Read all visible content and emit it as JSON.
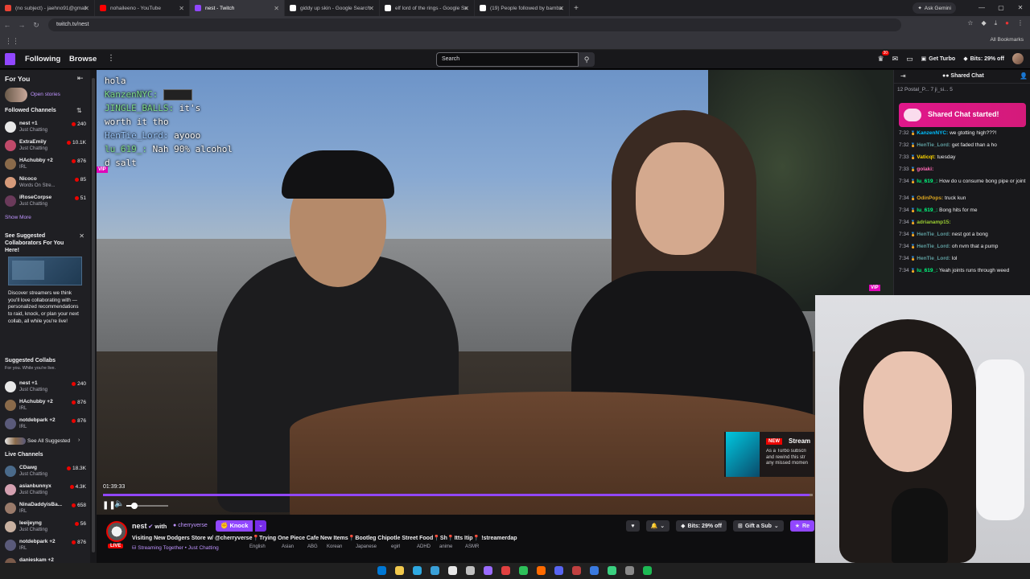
{
  "browser": {
    "tabs": [
      {
        "title": "(no subject) - jaehno91@gmail",
        "fav": "#ea4335"
      },
      {
        "title": "nohaileeno - YouTube",
        "fav": "#ff0000"
      },
      {
        "title": "nest - Twitch",
        "fav": "#9147ff"
      },
      {
        "title": "giddy up skin - Google Search",
        "fav": "#ffffff"
      },
      {
        "title": "elf lord of the rings - Google Se",
        "fav": "#ffffff"
      },
      {
        "title": "(19) People followed by bamba",
        "fav": "#ffffff"
      }
    ],
    "ask_gemini": "Ask Gemini",
    "url": "twitch.tv/nest",
    "all_bookmarks": "All Bookmarks"
  },
  "topnav": {
    "following": "Following",
    "browse": "Browse",
    "search_placeholder": "Search",
    "notif_count": "30",
    "get_turbo": "Get Turbo",
    "bits": "Bits: 29% off"
  },
  "sidebar": {
    "for_you": "For You",
    "open_stories": "Open stories",
    "followed_channels": "Followed Channels",
    "followed": [
      {
        "name": "nest +1",
        "cat": "Just Chatting",
        "viewers": "240",
        "color": "#e8e8e8"
      },
      {
        "name": "ExtraEmily",
        "cat": "Just Chatting",
        "viewers": "10.1K",
        "color": "#c04a6a"
      },
      {
        "name": "HAchubby +2",
        "cat": "IRL",
        "viewers": "876",
        "color": "#8a6a4a"
      },
      {
        "name": "Nicoco",
        "cat": "Words On Stre...",
        "viewers": "85",
        "color": "#d69a7a"
      },
      {
        "name": "iRoseCorpse",
        "cat": "Just Chatting",
        "viewers": "51",
        "color": "#6a3a5a"
      }
    ],
    "show_more": "Show More",
    "collab_title": "See Suggested Collaborators For You Here!",
    "collab_desc": "Discover streamers we think you'll love collaborating with — personalized recommendations to raid, knock, or plan your next collab, all while you're live!",
    "suggested_collabs": "Suggested Collabs",
    "for_you_while_live": "For you. While you're live.",
    "suggested": [
      {
        "name": "nest +1",
        "cat": "Just Chatting",
        "viewers": "240",
        "color": "#e8e8e8"
      },
      {
        "name": "HAchubby +2",
        "cat": "IRL",
        "viewers": "876",
        "color": "#8a6a4a"
      },
      {
        "name": "notdebpark +2",
        "cat": "IRL",
        "viewers": "876",
        "color": "#5a5a7a"
      }
    ],
    "see_all": "See All Suggested",
    "live_channels": "Live Channels",
    "live": [
      {
        "name": "CDawg",
        "cat": "Just Chatting",
        "viewers": "18.3K",
        "color": "#4a6a8a"
      },
      {
        "name": "asianbunnyx",
        "cat": "Just Chatting",
        "viewers": "4.3K",
        "color": "#d4a0b0"
      },
      {
        "name": "NinaDaddyisBa...",
        "cat": "IRL",
        "viewers": "658",
        "color": "#9a7a6a"
      },
      {
        "name": "leeijeyng",
        "cat": "Just Chatting",
        "viewers": "56",
        "color": "#c8b0a0"
      },
      {
        "name": "notdebpark +2",
        "cat": "IRL",
        "viewers": "876",
        "color": "#5a5a7a"
      },
      {
        "name": "danieskam +2",
        "cat": "",
        "viewers": "",
        "color": "#7a5a4a"
      }
    ]
  },
  "overlay_chat": [
    {
      "user": "",
      "text": "hola",
      "color": "#ffffff"
    },
    {
      "user": "KanzenNYC:",
      "text": "",
      "color": "#7fdc8c"
    },
    {
      "user": "JINGLE_BALLS:",
      "text": "it's",
      "color": "#7fdc8c"
    },
    {
      "user": "",
      "text": "worth it tho",
      "color": "#ffffff"
    },
    {
      "user": "HenTie_Lord:",
      "text": "ayooo",
      "color": "#9ac8ff"
    },
    {
      "user": "lu_619_:",
      "text": "Nah 90% alcohol",
      "color": "#7fdc8c"
    },
    {
      "user": "",
      "text": "d salt",
      "color": "#ffffff"
    }
  ],
  "vip_label": "VIP",
  "promo": {
    "new": "NEW",
    "title": "Stream",
    "desc": "As a Turbo subscri and rewind this str any missed momen"
  },
  "player": {
    "timestamp": "01:39:33",
    "progress": 0.995,
    "volume": 0.2
  },
  "stream": {
    "name": "nest",
    "with": "with",
    "cherry": "cherryverse",
    "knock": "Knock",
    "live": "LIVE",
    "title": "Visiting New Dodgers Store w/ @cherryverse📍Trying One Piece Cafe New Items📍Bootleg Chipotle Street Food📍Sh📍Itts Itip📍 !streamerdap",
    "category": "Streaming Together • Just Chatting",
    "tags": [
      "English",
      "Asian",
      "ABG",
      "Korean",
      "Japanese",
      "egirl",
      "ADHD",
      "anime",
      "ASMR"
    ],
    "bits": "Bits: 29% off",
    "gift": "Gift a Sub",
    "resub": "Re"
  },
  "chat": {
    "title": "Shared Chat",
    "subline": "12  Postal_P...  7  ji_si...  5",
    "banner": "Shared Chat started!",
    "messages": [
      {
        "t": "7:32",
        "u": "KanzenNYC:",
        "m": "we gtotting high???!",
        "c": "#00bfff"
      },
      {
        "t": "7:32",
        "u": "HenTie_Lord:",
        "m": "get faded than a ho",
        "c": "#5f9ea0"
      },
      {
        "t": "7:33",
        "u": "Vaticqt:",
        "m": "tuesday",
        "c": "#ffd700"
      },
      {
        "t": "7:33",
        "u": "golaki:",
        "m": "",
        "c": "#ff69b4"
      },
      {
        "t": "7:34",
        "u": "lu_619_:",
        "m": "How do u consume bong pipe or joint",
        "c": "#00ff7f"
      },
      {
        "t": "7:34",
        "u": "OdinPops:",
        "m": "truck kun",
        "c": "#daa520"
      },
      {
        "t": "7:34",
        "u": "lu_619_:",
        "m": "Bong hits for me",
        "c": "#00ff7f"
      },
      {
        "t": "7:34",
        "u": "adrianamp15:",
        "m": "",
        "c": "#9acd32"
      },
      {
        "t": "7:34",
        "u": "HenTie_Lord:",
        "m": "nest got a bong",
        "c": "#5f9ea0"
      },
      {
        "t": "7:34",
        "u": "HenTie_Lord:",
        "m": "oh nvm that a pump",
        "c": "#5f9ea0"
      },
      {
        "t": "7:34",
        "u": "HenTie_Lord:",
        "m": "lol",
        "c": "#5f9ea0"
      },
      {
        "t": "7:34",
        "u": "lu_619_:",
        "m": "Yeah joints runs through weed",
        "c": "#00ff7f"
      }
    ]
  },
  "taskbar": {
    "icons": [
      "#0078d4",
      "#f2c94c",
      "#2ea8e0",
      "#3aa0d8",
      "#e8e8e8",
      "#c0c0c0",
      "#9a6bff",
      "#e04040",
      "#2ec05a",
      "#ff6a00",
      "#5865f2",
      "#c04040",
      "#3a7adf",
      "#3ad080",
      "#888888",
      "#1db954"
    ]
  }
}
